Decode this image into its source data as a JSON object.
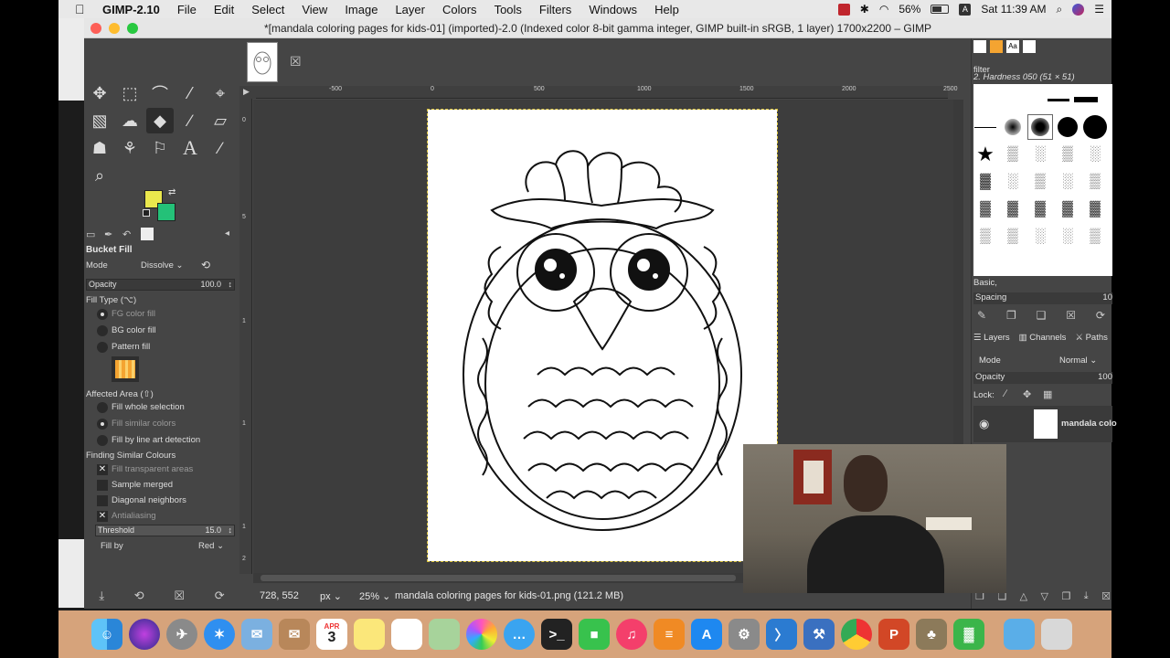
{
  "menubar": {
    "app_name": "GIMP-2.10",
    "items": [
      "File",
      "Edit",
      "Select",
      "View",
      "Image",
      "Layer",
      "Colors",
      "Tools",
      "Filters",
      "Windows",
      "Help"
    ],
    "battery": "56%",
    "clock": "Sat 11:39 AM"
  },
  "window": {
    "title": "*[mandala coloring pages for kids-01] (imported)-2.0 (Indexed color 8-bit gamma integer, GIMP built-in sRGB, 1 layer) 1700x2200 – GIMP"
  },
  "tool_options": {
    "title": "Bucket Fill",
    "mode_label": "Mode",
    "mode_value": "Dissolve",
    "opacity_label": "Opacity",
    "opacity_value": "100.0",
    "fill_type_label": "Fill Type  (⌥)",
    "fill_types": [
      "FG color fill",
      "BG color fill",
      "Pattern fill"
    ],
    "affected_area_label": "Affected Area  (⇧)",
    "affected_areas": [
      "Fill whole selection",
      "Fill similar colors",
      "Fill by line art detection"
    ],
    "finding_label": "Finding Similar Colours",
    "finding_options": [
      "Fill transparent areas",
      "Sample merged",
      "Diagonal neighbors",
      "Antialiasing"
    ],
    "threshold_label": "Threshold",
    "threshold_value": "15.0",
    "fill_by_label": "Fill by",
    "fill_by_value": "Red",
    "fg_color": "#ebe84d",
    "bg_color": "#24c178"
  },
  "rulers": {
    "h_ticks": [
      "-500",
      "0",
      "500",
      "1000",
      "1500",
      "2000",
      "2500"
    ],
    "v_ticks": [
      "0",
      "5",
      "1",
      "1",
      "1",
      "2"
    ]
  },
  "statusbar": {
    "coords": "728, 552",
    "unit": "px",
    "zoom": "25%",
    "file_info": "mandala coloring pages for kids-01.png (121.2 MB)"
  },
  "brushes": {
    "filter_placeholder": "filter",
    "selected": "2. Hardness 050 (51 × 51)",
    "tag": "Basic,",
    "spacing_label": "Spacing",
    "spacing_value": "10"
  },
  "layers": {
    "tabs": [
      "Layers",
      "Channels",
      "Paths"
    ],
    "mode_label": "Mode",
    "mode_value": "Normal",
    "opacity_label": "Opacity",
    "opacity_value": "100",
    "lock_label": "Lock:",
    "layer_name": "mandala colo"
  },
  "dock_apps": [
    "Finder",
    "Siri",
    "Launchpad",
    "Safari",
    "Mail",
    "Contacts",
    "Calendar",
    "Notes",
    "Reminders",
    "Maps",
    "Photos",
    "Messages",
    "Terminal",
    "FaceTime",
    "Music",
    "Books",
    "App Store",
    "System Preferences",
    "VS Code",
    "Xcode",
    "Chrome",
    "PowerPoint",
    "GIMP",
    "Numbers",
    "Downloads",
    "Trash"
  ],
  "calendar": {
    "month": "APR",
    "day": "3"
  }
}
